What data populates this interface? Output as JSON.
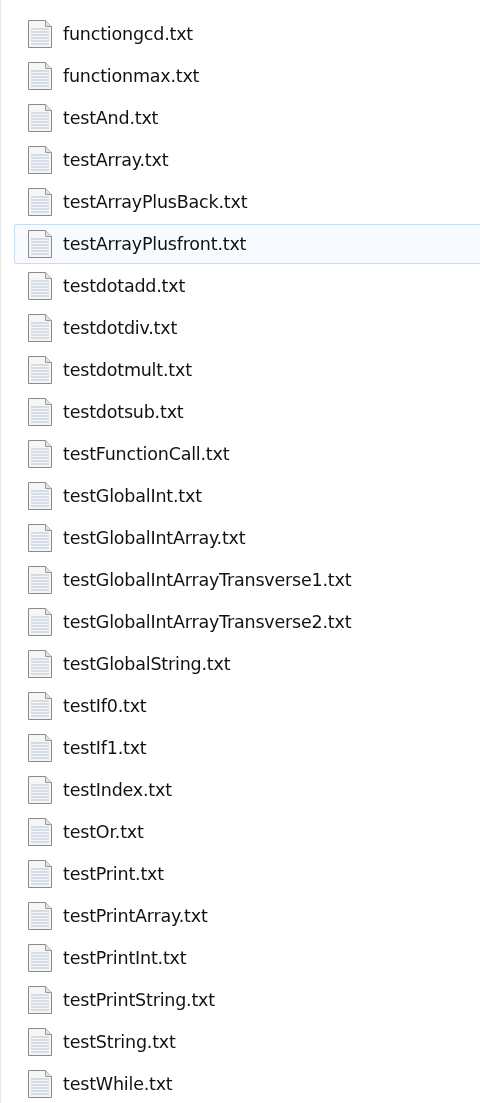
{
  "files": [
    {
      "name": "functiongcd.txt",
      "selected": false
    },
    {
      "name": "functionmax.txt",
      "selected": false
    },
    {
      "name": "testAnd.txt",
      "selected": false
    },
    {
      "name": "testArray.txt",
      "selected": false
    },
    {
      "name": "testArrayPlusBack.txt",
      "selected": false
    },
    {
      "name": "testArrayPlusfront.txt",
      "selected": true
    },
    {
      "name": "testdotadd.txt",
      "selected": false
    },
    {
      "name": "testdotdiv.txt",
      "selected": false
    },
    {
      "name": "testdotmult.txt",
      "selected": false
    },
    {
      "name": "testdotsub.txt",
      "selected": false
    },
    {
      "name": "testFunctionCall.txt",
      "selected": false
    },
    {
      "name": "testGlobalInt.txt",
      "selected": false
    },
    {
      "name": "testGlobalIntArray.txt",
      "selected": false
    },
    {
      "name": "testGlobalIntArrayTransverse1.txt",
      "selected": false
    },
    {
      "name": "testGlobalIntArrayTransverse2.txt",
      "selected": false
    },
    {
      "name": "testGlobalString.txt",
      "selected": false
    },
    {
      "name": "testIf0.txt",
      "selected": false
    },
    {
      "name": "testIf1.txt",
      "selected": false
    },
    {
      "name": "testIndex.txt",
      "selected": false
    },
    {
      "name": "testOr.txt",
      "selected": false
    },
    {
      "name": "testPrint.txt",
      "selected": false
    },
    {
      "name": "testPrintArray.txt",
      "selected": false
    },
    {
      "name": "testPrintInt.txt",
      "selected": false
    },
    {
      "name": "testPrintString.txt",
      "selected": false
    },
    {
      "name": "testString.txt",
      "selected": false
    },
    {
      "name": "testWhile.txt",
      "selected": false
    }
  ]
}
